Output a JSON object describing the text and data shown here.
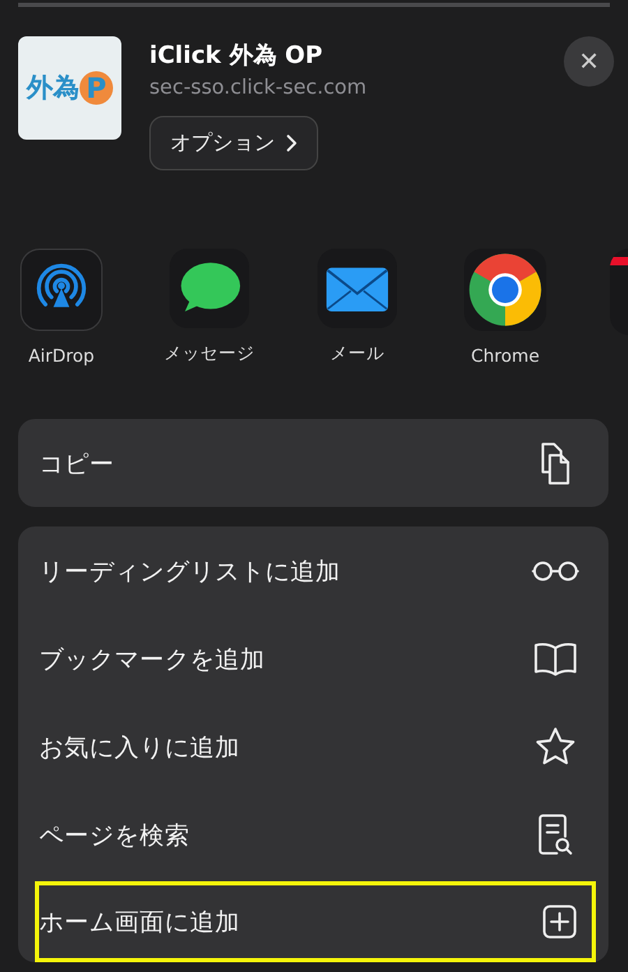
{
  "header": {
    "logo_text": "外為",
    "logo_mark": "P",
    "title": "iClick 外為 OP",
    "url": "sec-sso.click-sec.com",
    "options_button": "オプション",
    "close": "✕"
  },
  "apps": [
    {
      "label": "AirDrop"
    },
    {
      "label": "メッセージ"
    },
    {
      "label": "メール"
    },
    {
      "label": "Chrome"
    }
  ],
  "action_groups": [
    [
      {
        "label": "コピー",
        "highlighted": false
      }
    ],
    [
      {
        "label": "リーディングリストに追加",
        "highlighted": false
      },
      {
        "label": "ブックマークを追加",
        "highlighted": false
      },
      {
        "label": "お気に入りに追加",
        "highlighted": false
      },
      {
        "label": "ページを検索",
        "highlighted": false
      },
      {
        "label": "ホーム画面に追加",
        "highlighted": true
      }
    ]
  ]
}
